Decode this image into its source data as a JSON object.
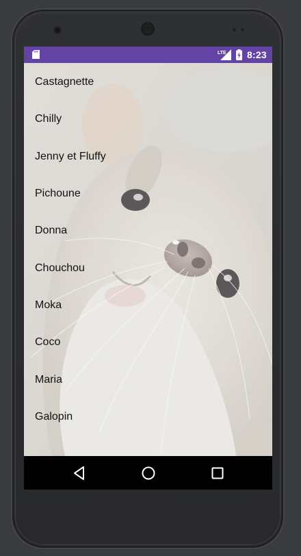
{
  "status_bar": {
    "time": "8:23",
    "network": "LTE",
    "color": "#6344a5"
  },
  "names": [
    "Castagnette",
    "Chilly",
    "Jenny et Fluffy",
    "Pichoune",
    "Donna",
    "Chouchou",
    "Moka",
    "Coco",
    "Maria",
    "Galopin"
  ],
  "nav_bar": {
    "back_icon": "back-triangle-icon",
    "home_icon": "home-circle-icon",
    "recents_icon": "recents-square-icon"
  }
}
